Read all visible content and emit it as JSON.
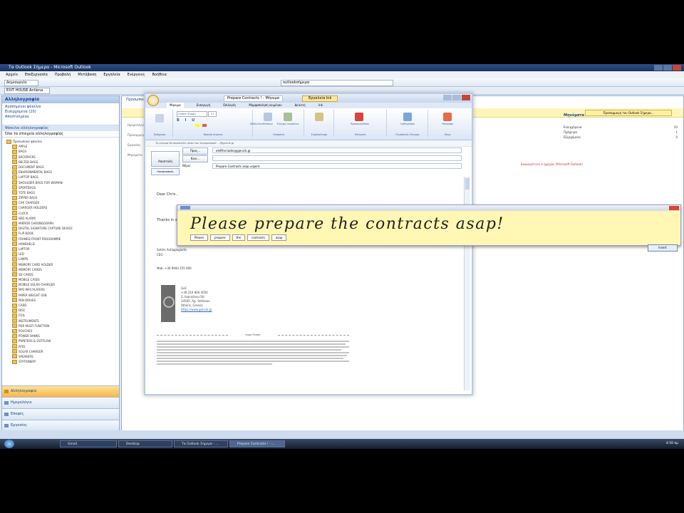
{
  "outlook": {
    "title": "Τα Outlook Σήμερα - Microsoft Outlook",
    "menu": [
      "Αρχείο",
      "Επεξεργασία",
      "Προβολή",
      "Μετάβαση",
      "Εργαλεία",
      "Ενέργειες",
      "Βοήθεια"
    ],
    "new_button": "Δημιουργία",
    "search_value": "outlookσήμερα",
    "account_select": "EXIT HOUSE Antiena"
  },
  "nav": {
    "header": "Αλληλογραφία",
    "favorites_label": "Αγαπημένοι φάκελοι",
    "favorites": [
      "Εισερχόμενα (20)",
      "Απεσταλμένα"
    ],
    "mail_folders_label": "Φάκελοι αλληλογραφίας",
    "all_items": "Όλα τα στοιχεία αλληλογραφίας",
    "folders": [
      "Προσωπικοί φάκελοι",
      "APPLE",
      "BAGS",
      "BACKPACKS",
      "BELTED BAGS",
      "DOCUMENT BAGS",
      "ENVIRONMENTAL BAGS",
      "LAPTOP BAGS",
      "SHOULDER BAGS FOR WOMAN",
      "SPORTBAGS",
      "TOTE BAGS",
      "ZIPPER BAGS",
      "CAR CHARGER",
      "CHARGER HOLDERS",
      "CLOCK",
      "BED ALARM",
      "MIRROR CHRONOGRAPH",
      "DIGITAL SIGNATURE CAPTURE DEVICE",
      "FLIP BOOK",
      "FRAMED FRONT PROGRAMME",
      "HANDHELD",
      "LAPTOP",
      "LED",
      "LAMPS",
      "MEMORY CARD HOLDER",
      "MEMORY CARDS",
      "SD CARDS",
      "MOBILE CASES",
      "MOBILE SOLAR CHARGER",
      "MP3 MP4 PLAYERS",
      "PAPER WEIGHT USB",
      "PEN DRIVES",
      "CARD",
      "DISC",
      "FOIL",
      "INSTRUMENTS",
      "PDR MULTI FUNCTION",
      "POUCHES",
      "POWER BANKS",
      "PRINTERS & OUTFLOW",
      "RFID",
      "SOLAR CHARGER",
      "SPEAKERS",
      "STATIONERY"
    ],
    "buttons": [
      "Αλληλογραφία",
      "Ημερολόγιο",
      "Επαφές",
      "Εργασίες"
    ]
  },
  "main": {
    "tab_label": "Προσωπικοί φάκελοι - Outlook Σήμερα",
    "info_button": "Προσαρμογή του Outlook Σήμερα...",
    "labels": [
      "Ημερολόγιο",
      "Προσαρμογή",
      "Εργασίες",
      "Μηνύματα"
    ],
    "red_notice": "Εκκρεμότητα 4 ημερών (Microsoft Outlook)",
    "todo_header": "Μηνύματα",
    "todo_rows": [
      {
        "label": "Εισερχόμενα",
        "value": "20"
      },
      {
        "label": "Πρόχειρα",
        "value": "1"
      },
      {
        "label": "Εξερχόμενα",
        "value": "0"
      }
    ]
  },
  "compose": {
    "window_title": "Prepare Contracts ! - Μήνυμα",
    "tools_tab": "Εργαλεία Ink",
    "tabs": [
      "Μήνυμα",
      "Εισαγωγή",
      "Επιλογές",
      "Μορφοποίηση κειμένου",
      "Δείκτες",
      "Ink"
    ],
    "font_value": "Calibri (Σώμα)",
    "font_size": "11",
    "group_clipboard": "Πρόχειρο",
    "group_basic_text": "Βασικό κείμενο",
    "group_names": "Ονόματα",
    "group_include": "Συμπερίληψη",
    "group_options": "Επιλογές",
    "group_proofing": "Γλωσσικός έλεγχος",
    "group_zoom": "Ζουμ",
    "btn_addressbook": "Βιβλίο διευθύνσεων",
    "btn_checknames": "Έλεγχος ονομάτων",
    "btn_followup": "Παρακολούθηση",
    "btn_spelling": "Ορθογραφία",
    "btn_signature": "Υπογραφή",
    "info_line": "Το μήνυμα θα αποσταλεί μέσω του λογαριασμού: ...@gencik.gr",
    "to_label": "Προς...",
    "cc_label": "Κοιν...",
    "subject_label": "Θέμα:",
    "to_value": "eleftheriades@gencik.gr",
    "subject_value": "Prepare Contracts asap urgent",
    "send_label": "Αποστολή",
    "account_label": "Λογαριασμός",
    "body_greeting": "Dear Chris ,",
    "body_thanks": "Thanks in advance",
    "sig_name": "Sotiris Antiagiogiadis",
    "sig_role": "CEO",
    "sig_mob": "Mob. +30 6944 255 000",
    "sig_company": "GoC",
    "sig_phone": "+30 210 800 4050",
    "sig_street": "2, Ioannitsou Str.",
    "sig_city": "14565, Ag. Stefanos",
    "sig_country": "Athens, Greece",
    "sig_web": "https://www.gencik.gr",
    "legal_title": "Legal Footer"
  },
  "ink": {
    "handwritten_text": "Please prepare the contracts asap!",
    "recognized_words": [
      "Please",
      "prepare",
      "the",
      "contracts",
      "asap"
    ],
    "insert_button": "Insert"
  },
  "taskbar": {
    "items": [
      "Gmail",
      "Desktop",
      "Τα Outlook Σήμερα - ...",
      "Prepare Contracts ! - ..."
    ],
    "clock": "4:50 πμ"
  }
}
